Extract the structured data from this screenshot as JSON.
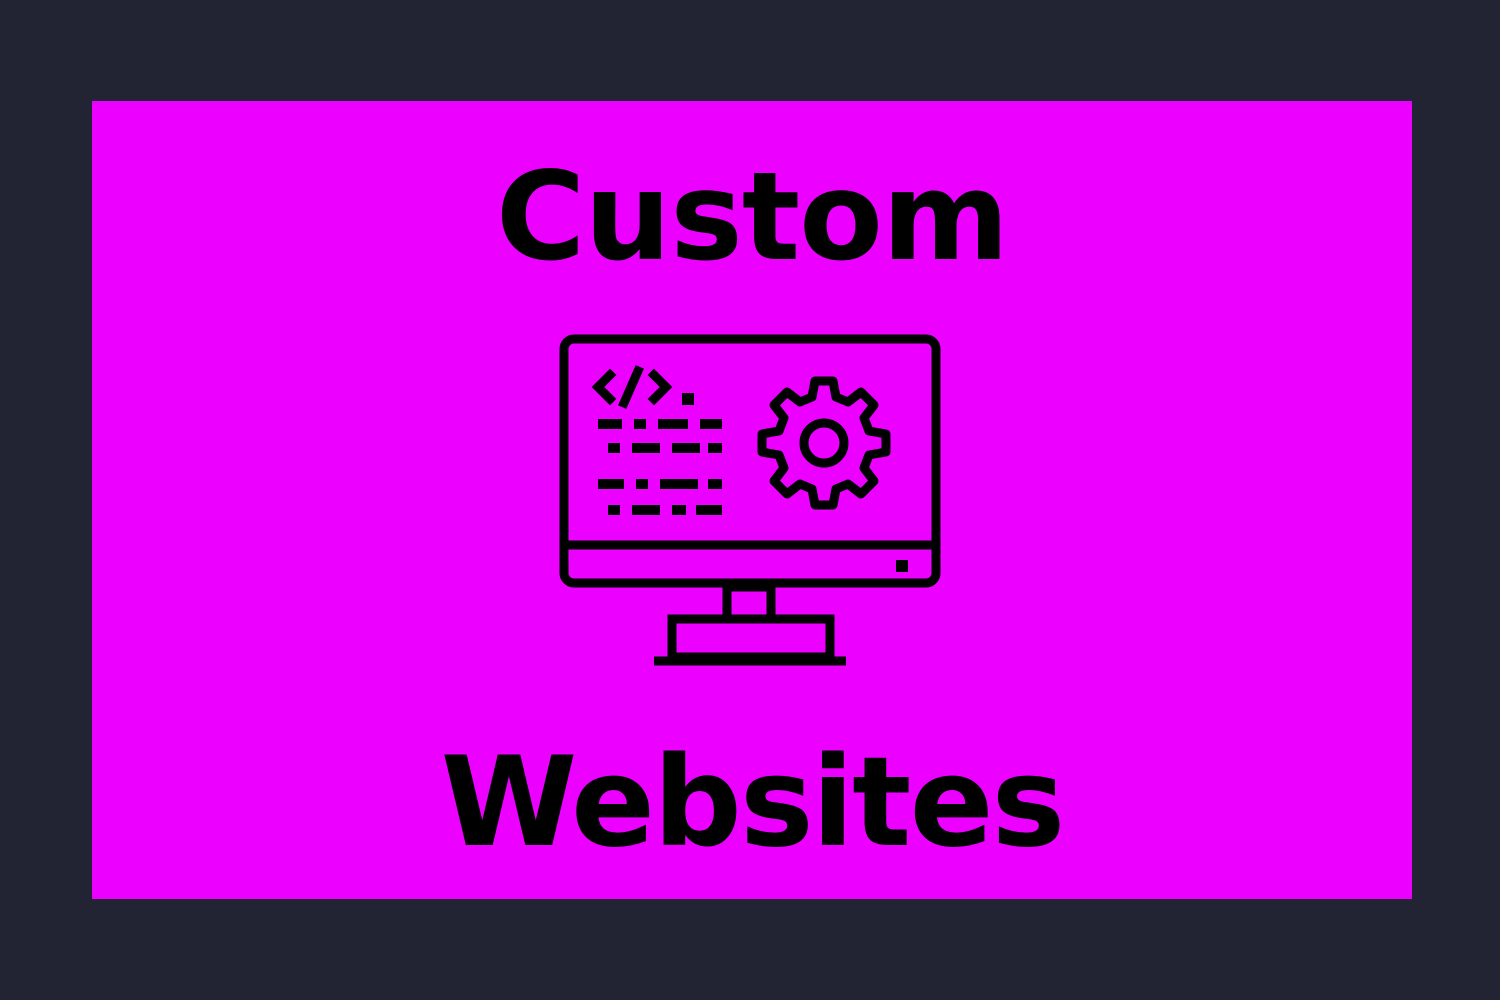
{
  "colors": {
    "page_background": "#232433",
    "card_background": "#ec00ff",
    "ink": "#000000"
  },
  "card": {
    "heading_top": "Custom",
    "heading_bottom": "Websites",
    "icon": "monitor-code-gear-icon"
  }
}
